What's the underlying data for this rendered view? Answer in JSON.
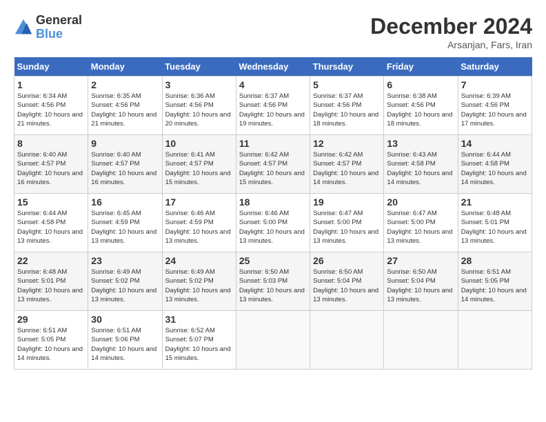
{
  "header": {
    "logo_line1": "General",
    "logo_line2": "Blue",
    "month_title": "December 2024",
    "location": "Arsanjan, Fars, Iran"
  },
  "weekdays": [
    "Sunday",
    "Monday",
    "Tuesday",
    "Wednesday",
    "Thursday",
    "Friday",
    "Saturday"
  ],
  "weeks": [
    [
      {
        "day": 1,
        "sunrise": "6:34 AM",
        "sunset": "4:56 PM",
        "daylight": "10 hours and 21 minutes."
      },
      {
        "day": 2,
        "sunrise": "6:35 AM",
        "sunset": "4:56 PM",
        "daylight": "10 hours and 21 minutes."
      },
      {
        "day": 3,
        "sunrise": "6:36 AM",
        "sunset": "4:56 PM",
        "daylight": "10 hours and 20 minutes."
      },
      {
        "day": 4,
        "sunrise": "6:37 AM",
        "sunset": "4:56 PM",
        "daylight": "10 hours and 19 minutes."
      },
      {
        "day": 5,
        "sunrise": "6:37 AM",
        "sunset": "4:56 PM",
        "daylight": "10 hours and 18 minutes."
      },
      {
        "day": 6,
        "sunrise": "6:38 AM",
        "sunset": "4:56 PM",
        "daylight": "10 hours and 18 minutes."
      },
      {
        "day": 7,
        "sunrise": "6:39 AM",
        "sunset": "4:56 PM",
        "daylight": "10 hours and 17 minutes."
      }
    ],
    [
      {
        "day": 8,
        "sunrise": "6:40 AM",
        "sunset": "4:57 PM",
        "daylight": "10 hours and 16 minutes."
      },
      {
        "day": 9,
        "sunrise": "6:40 AM",
        "sunset": "4:57 PM",
        "daylight": "10 hours and 16 minutes."
      },
      {
        "day": 10,
        "sunrise": "6:41 AM",
        "sunset": "4:57 PM",
        "daylight": "10 hours and 15 minutes."
      },
      {
        "day": 11,
        "sunrise": "6:42 AM",
        "sunset": "4:57 PM",
        "daylight": "10 hours and 15 minutes."
      },
      {
        "day": 12,
        "sunrise": "6:42 AM",
        "sunset": "4:57 PM",
        "daylight": "10 hours and 14 minutes."
      },
      {
        "day": 13,
        "sunrise": "6:43 AM",
        "sunset": "4:58 PM",
        "daylight": "10 hours and 14 minutes."
      },
      {
        "day": 14,
        "sunrise": "6:44 AM",
        "sunset": "4:58 PM",
        "daylight": "10 hours and 14 minutes."
      }
    ],
    [
      {
        "day": 15,
        "sunrise": "6:44 AM",
        "sunset": "4:58 PM",
        "daylight": "10 hours and 13 minutes."
      },
      {
        "day": 16,
        "sunrise": "6:45 AM",
        "sunset": "4:59 PM",
        "daylight": "10 hours and 13 minutes."
      },
      {
        "day": 17,
        "sunrise": "6:46 AM",
        "sunset": "4:59 PM",
        "daylight": "10 hours and 13 minutes."
      },
      {
        "day": 18,
        "sunrise": "6:46 AM",
        "sunset": "5:00 PM",
        "daylight": "10 hours and 13 minutes."
      },
      {
        "day": 19,
        "sunrise": "6:47 AM",
        "sunset": "5:00 PM",
        "daylight": "10 hours and 13 minutes."
      },
      {
        "day": 20,
        "sunrise": "6:47 AM",
        "sunset": "5:00 PM",
        "daylight": "10 hours and 13 minutes."
      },
      {
        "day": 21,
        "sunrise": "6:48 AM",
        "sunset": "5:01 PM",
        "daylight": "10 hours and 13 minutes."
      }
    ],
    [
      {
        "day": 22,
        "sunrise": "6:48 AM",
        "sunset": "5:01 PM",
        "daylight": "10 hours and 13 minutes."
      },
      {
        "day": 23,
        "sunrise": "6:49 AM",
        "sunset": "5:02 PM",
        "daylight": "10 hours and 13 minutes."
      },
      {
        "day": 24,
        "sunrise": "6:49 AM",
        "sunset": "5:02 PM",
        "daylight": "10 hours and 13 minutes."
      },
      {
        "day": 25,
        "sunrise": "6:50 AM",
        "sunset": "5:03 PM",
        "daylight": "10 hours and 13 minutes."
      },
      {
        "day": 26,
        "sunrise": "6:50 AM",
        "sunset": "5:04 PM",
        "daylight": "10 hours and 13 minutes."
      },
      {
        "day": 27,
        "sunrise": "6:50 AM",
        "sunset": "5:04 PM",
        "daylight": "10 hours and 13 minutes."
      },
      {
        "day": 28,
        "sunrise": "6:51 AM",
        "sunset": "5:05 PM",
        "daylight": "10 hours and 14 minutes."
      }
    ],
    [
      {
        "day": 29,
        "sunrise": "6:51 AM",
        "sunset": "5:05 PM",
        "daylight": "10 hours and 14 minutes."
      },
      {
        "day": 30,
        "sunrise": "6:51 AM",
        "sunset": "5:06 PM",
        "daylight": "10 hours and 14 minutes."
      },
      {
        "day": 31,
        "sunrise": "6:52 AM",
        "sunset": "5:07 PM",
        "daylight": "10 hours and 15 minutes."
      },
      null,
      null,
      null,
      null
    ]
  ]
}
